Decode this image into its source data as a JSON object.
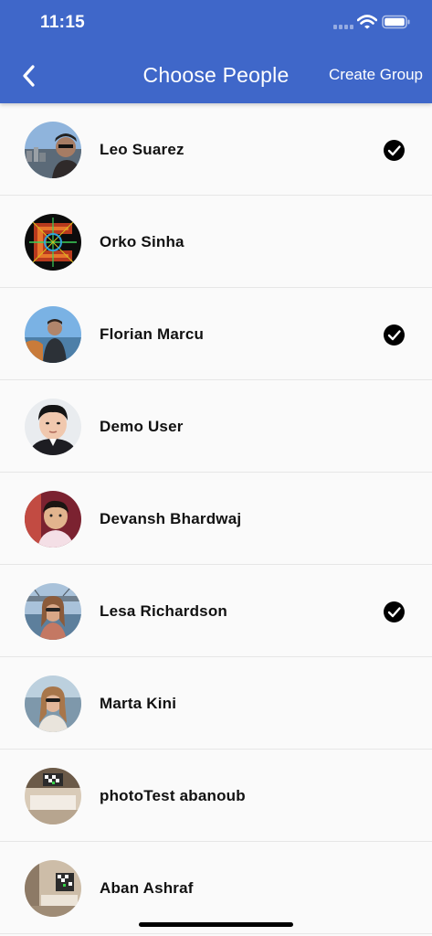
{
  "status_bar": {
    "time": "11:15"
  },
  "nav": {
    "title": "Choose People",
    "action_label": "Create Group"
  },
  "people": [
    {
      "name": "Leo Suarez",
      "selected": true,
      "avatar_icon": "profile-photo"
    },
    {
      "name": "Orko Sinha",
      "selected": false,
      "avatar_icon": "profile-photo"
    },
    {
      "name": "Florian Marcu",
      "selected": true,
      "avatar_icon": "profile-photo"
    },
    {
      "name": "Demo User",
      "selected": false,
      "avatar_icon": "profile-photo"
    },
    {
      "name": "Devansh Bhardwaj",
      "selected": false,
      "avatar_icon": "profile-photo"
    },
    {
      "name": "Lesa Richardson",
      "selected": true,
      "avatar_icon": "profile-photo"
    },
    {
      "name": "Marta Kini",
      "selected": false,
      "avatar_icon": "profile-photo"
    },
    {
      "name": "photoTest abanoub",
      "selected": false,
      "avatar_icon": "profile-photo"
    },
    {
      "name": "Aban Ashraf",
      "selected": false,
      "avatar_icon": "profile-photo"
    }
  ],
  "colors": {
    "header_background": "#3f67c9",
    "header_text": "#ffffff",
    "list_background": "#fafafa",
    "divider": "#e6e6e6",
    "selected_check": "#000000"
  }
}
